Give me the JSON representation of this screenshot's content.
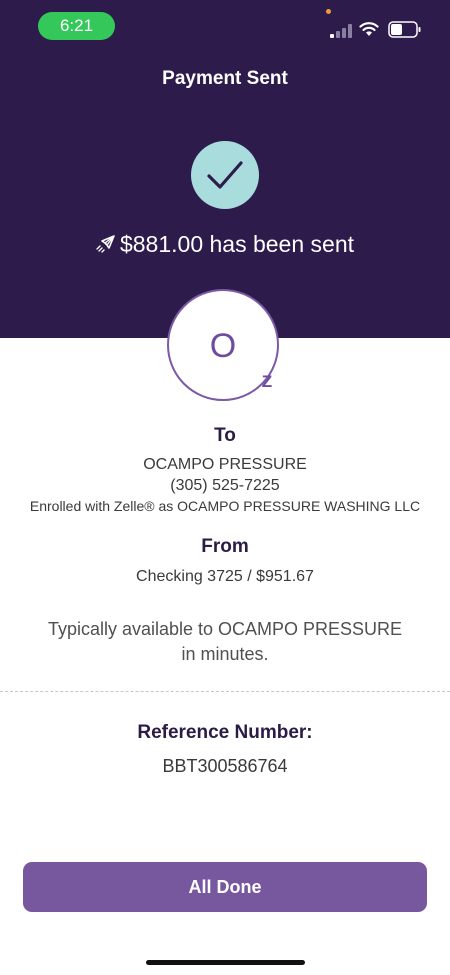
{
  "status_bar": {
    "time": "6:21"
  },
  "header": {
    "title": "Payment Sent",
    "sent_message": "$881.00 has been sent"
  },
  "recipient": {
    "avatar_letter": "O",
    "badge": "Z"
  },
  "to_section": {
    "label": "To",
    "name": "OCAMPO PRESSURE",
    "phone": "(305) 525-7225",
    "enrollment": "Enrolled with Zelle® as OCAMPO PRESSURE WASHING LLC"
  },
  "from_section": {
    "label": "From",
    "account": "Checking 3725 / $951.67"
  },
  "availability": {
    "line1": "Typically available to OCAMPO PRESSURE",
    "line2": "in minutes."
  },
  "reference": {
    "label": "Reference Number:",
    "number": "BBT300586764"
  },
  "actions": {
    "done_label": "All Done"
  },
  "colors": {
    "header_bg": "#2d1b4b",
    "accent_purple": "#77589e",
    "check_circle": "#a9dcdc",
    "time_pill": "#34c759"
  },
  "icons": {
    "check": "checkmark-icon",
    "rocket": "rocket-icon",
    "signal": "cellular-signal-icon",
    "wifi": "wifi-icon",
    "battery": "battery-icon"
  }
}
